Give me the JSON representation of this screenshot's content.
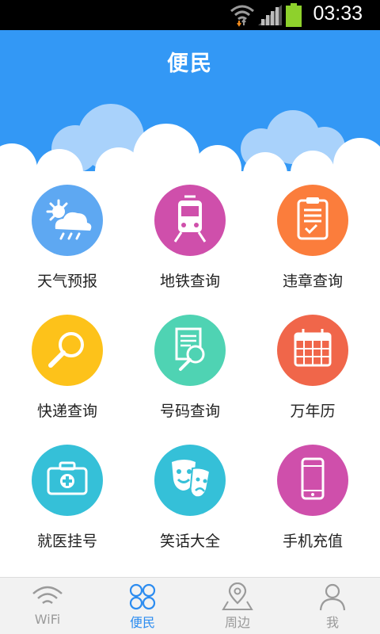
{
  "status_bar": {
    "time": "03:33"
  },
  "header": {
    "title": "便民"
  },
  "grid": {
    "items": [
      {
        "label": "天气预报",
        "icon": "weather-icon",
        "color": "#5ea8f2"
      },
      {
        "label": "地铁查询",
        "icon": "subway-icon",
        "color": "#cf4fab"
      },
      {
        "label": "违章查询",
        "icon": "clipboard-icon",
        "color": "#fb7d3c"
      },
      {
        "label": "快递查询",
        "icon": "magnifier-icon",
        "color": "#fdc21a"
      },
      {
        "label": "号码查询",
        "icon": "document-search-icon",
        "color": "#4fd3b3"
      },
      {
        "label": "万年历",
        "icon": "calendar-icon",
        "color": "#f0664a"
      },
      {
        "label": "就医挂号",
        "icon": "medical-kit-icon",
        "color": "#35c0d8"
      },
      {
        "label": "笑话大全",
        "icon": "theater-masks-icon",
        "color": "#35c0d8"
      },
      {
        "label": "手机充值",
        "icon": "phone-icon",
        "color": "#cf4fab"
      }
    ]
  },
  "tabbar": {
    "tabs": [
      {
        "label": "WiFi",
        "icon": "wifi-icon",
        "active": false
      },
      {
        "label": "便民",
        "icon": "four-circles-icon",
        "active": true
      },
      {
        "label": "周边",
        "icon": "map-pin-icon",
        "active": false
      },
      {
        "label": "我",
        "icon": "person-icon",
        "active": false
      }
    ],
    "active_color": "#2c8cf0",
    "inactive_color": "#9a9a9a"
  },
  "colors": {
    "header_blue": "#3398f5",
    "status_bg": "#000000",
    "battery_green": "#8ed12c"
  }
}
